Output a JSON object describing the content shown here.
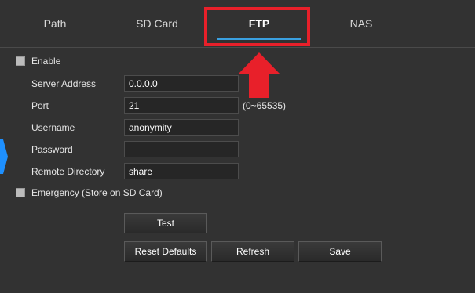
{
  "tabs": [
    {
      "label": "Path"
    },
    {
      "label": "SD Card"
    },
    {
      "label": "FTP",
      "active": true
    },
    {
      "label": "NAS"
    }
  ],
  "form": {
    "enable_label": "Enable",
    "server_address": {
      "label": "Server Address",
      "value": "0.0.0.0"
    },
    "port": {
      "label": "Port",
      "value": "21",
      "hint": "(0~65535)"
    },
    "username": {
      "label": "Username",
      "value": "anonymity"
    },
    "password": {
      "label": "Password",
      "value": ""
    },
    "remote_directory": {
      "label": "Remote Directory",
      "value": "share"
    },
    "emergency_label": "Emergency (Store on SD Card)"
  },
  "buttons": {
    "test": "Test",
    "reset_defaults": "Reset Defaults",
    "refresh": "Refresh",
    "save": "Save"
  },
  "colors": {
    "background": "#323232",
    "active_tab_underline": "#3aa0e0",
    "annotation_red": "#e8202a",
    "side_chevron": "#1e90ff"
  }
}
